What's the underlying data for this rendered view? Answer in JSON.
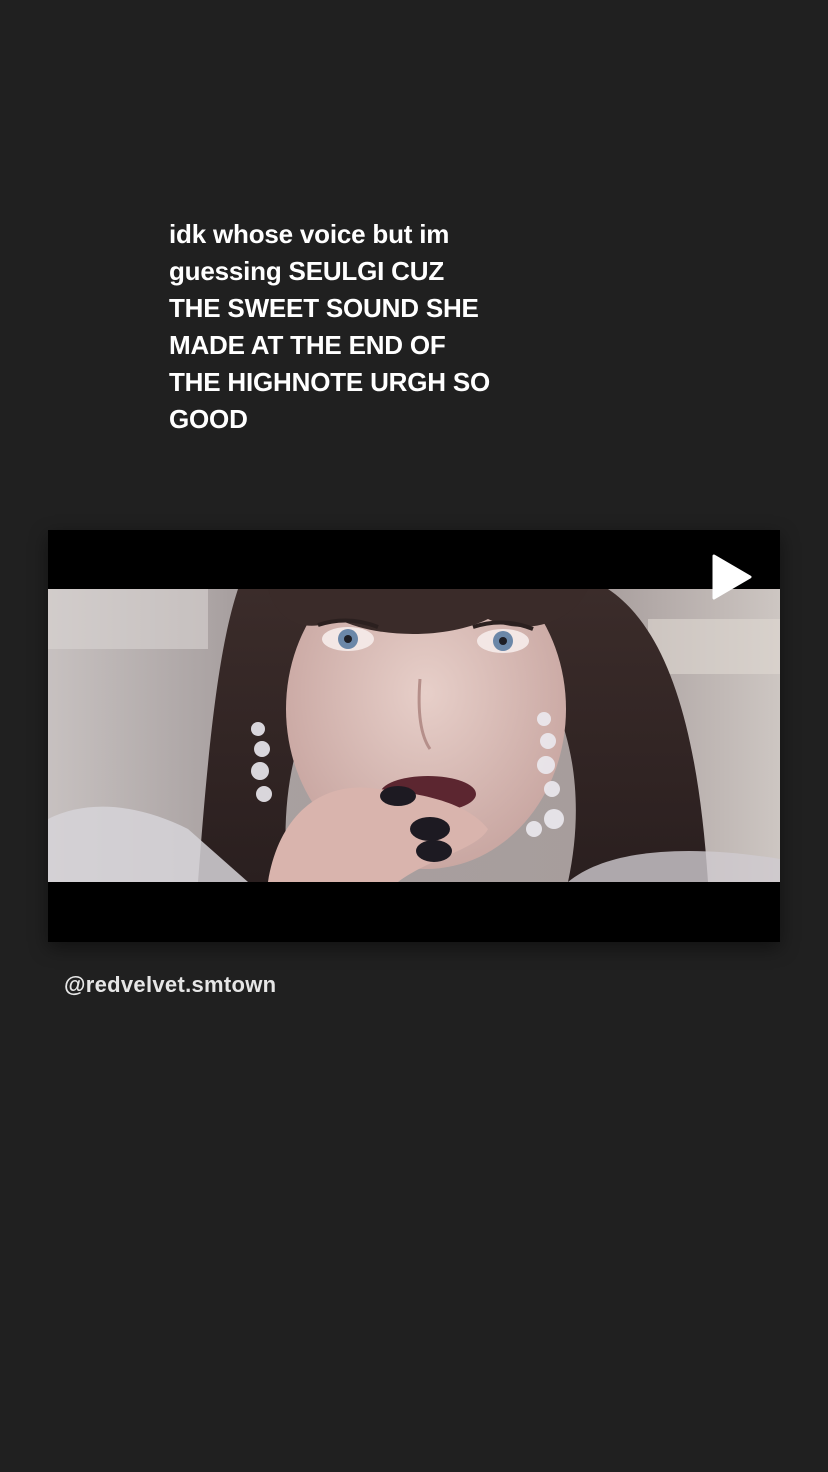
{
  "story": {
    "text_lines": [
      "idk whose voice but im",
      "guessing SEULGI CUZ",
      "THE SWEET SOUND SHE",
      "MADE AT THE END OF",
      "THE HIGHNOTE URGH SO",
      "GOOD"
    ],
    "mention": "@redvelvet.smtown"
  },
  "video": {
    "play_icon": "play-icon",
    "state": "paused"
  },
  "colors": {
    "background": "#202020",
    "video_letterbox": "#000000",
    "text": "#ffffff"
  }
}
